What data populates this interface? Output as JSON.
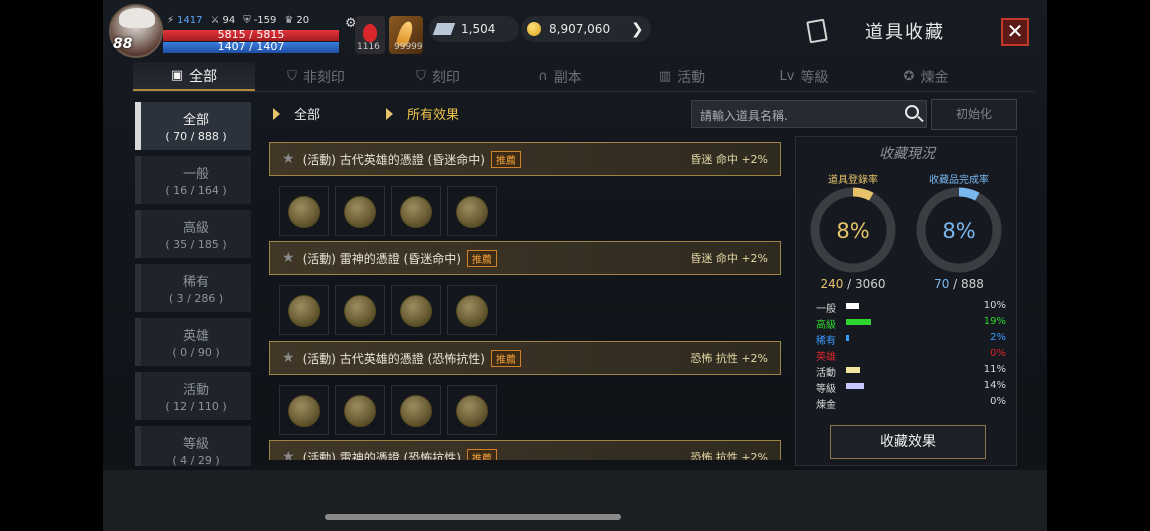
{
  "hud": {
    "level": "88",
    "power": "1417",
    "stat_attack": "94",
    "stat_defense": "-159",
    "stat_trophy": "20",
    "hp": "5815 / 5815",
    "mp": "1407 / 1407",
    "potion_count": "1116",
    "item_count": "99999",
    "crystal": "1,504",
    "gold": "8,907,060"
  },
  "header": {
    "title": "道具收藏",
    "close": "✕"
  },
  "tabs": [
    {
      "label": "全部",
      "icon": "book-icon"
    },
    {
      "label": "非刻印",
      "icon": "shield-icon"
    },
    {
      "label": "刻印",
      "icon": "shield-mark-icon"
    },
    {
      "label": "副本",
      "icon": "arch-icon"
    },
    {
      "label": "活動",
      "icon": "gift-icon"
    },
    {
      "label": "等級",
      "icon": "level-icon"
    },
    {
      "label": "煉金",
      "icon": "star-icon"
    }
  ],
  "filters": [
    {
      "label": "全部",
      "count": "( 70 / 888 )"
    },
    {
      "label": "一般",
      "count": "( 16 / 164 )"
    },
    {
      "label": "高級",
      "count": "( 35 / 185 )"
    },
    {
      "label": "稀有",
      "count": "( 3 / 286 )"
    },
    {
      "label": "英雄",
      "count": "( 0 / 90 )"
    },
    {
      "label": "活動",
      "count": "( 12 / 110 )"
    },
    {
      "label": "等級",
      "count": "( 4 / 29 )"
    }
  ],
  "subheader": {
    "filter_left": "全部",
    "filter_right": "所有效果",
    "search_placeholder": "請輸入道具名稱.",
    "reset_label": "初始化"
  },
  "entries": [
    {
      "title": "(活動) 古代英雄的憑證 (昏迷命中)",
      "badge": "推薦",
      "effect": "昏迷 命中 +2%"
    },
    {
      "title": "(活動) 雷神的憑證 (昏迷命中)",
      "badge": "推薦",
      "effect": "昏迷 命中 +2%"
    },
    {
      "title": "(活動) 古代英雄的憑證 (恐怖抗性)",
      "badge": "推薦",
      "effect": "恐怖 抗性 +2%"
    },
    {
      "title": "(活動) 雷神的憑證 (恐怖抗性)",
      "badge": "推薦",
      "effect": "恐怖 抗性 +2%"
    }
  ],
  "panel": {
    "title": "收藏現況",
    "reg_label": "道具登錄率",
    "reg_pct": "8%",
    "reg_fraction": 0.08,
    "reg_current": "240",
    "reg_total": " / 3060",
    "comp_label": "收藏品完成率",
    "comp_pct": "8%",
    "comp_fraction": 0.08,
    "comp_current": "70",
    "comp_total": " / 888",
    "grades": [
      {
        "name": "一般",
        "pct": "10%",
        "value": 10,
        "color": "#ffffff"
      },
      {
        "name": "高級",
        "pct": "19%",
        "value": 19,
        "color": "#2fd62f"
      },
      {
        "name": "稀有",
        "pct": "2%",
        "value": 2,
        "color": "#3a9cff"
      },
      {
        "name": "英雄",
        "pct": "0%",
        "value": 0,
        "color": "#d8262c"
      },
      {
        "name": "活動",
        "pct": "11%",
        "value": 11,
        "color": "#f2e6a0"
      },
      {
        "name": "等級",
        "pct": "14%",
        "value": 14,
        "color": "#c8c8ff"
      },
      {
        "name": "煉金",
        "pct": "0%",
        "value": 0,
        "color": "#bbbbbb"
      }
    ],
    "effect_button": "收藏效果"
  },
  "colors": {
    "accent_gold": "#e6c36a",
    "accent_blue": "#7ab7ee",
    "close_red": "#c0392b"
  }
}
